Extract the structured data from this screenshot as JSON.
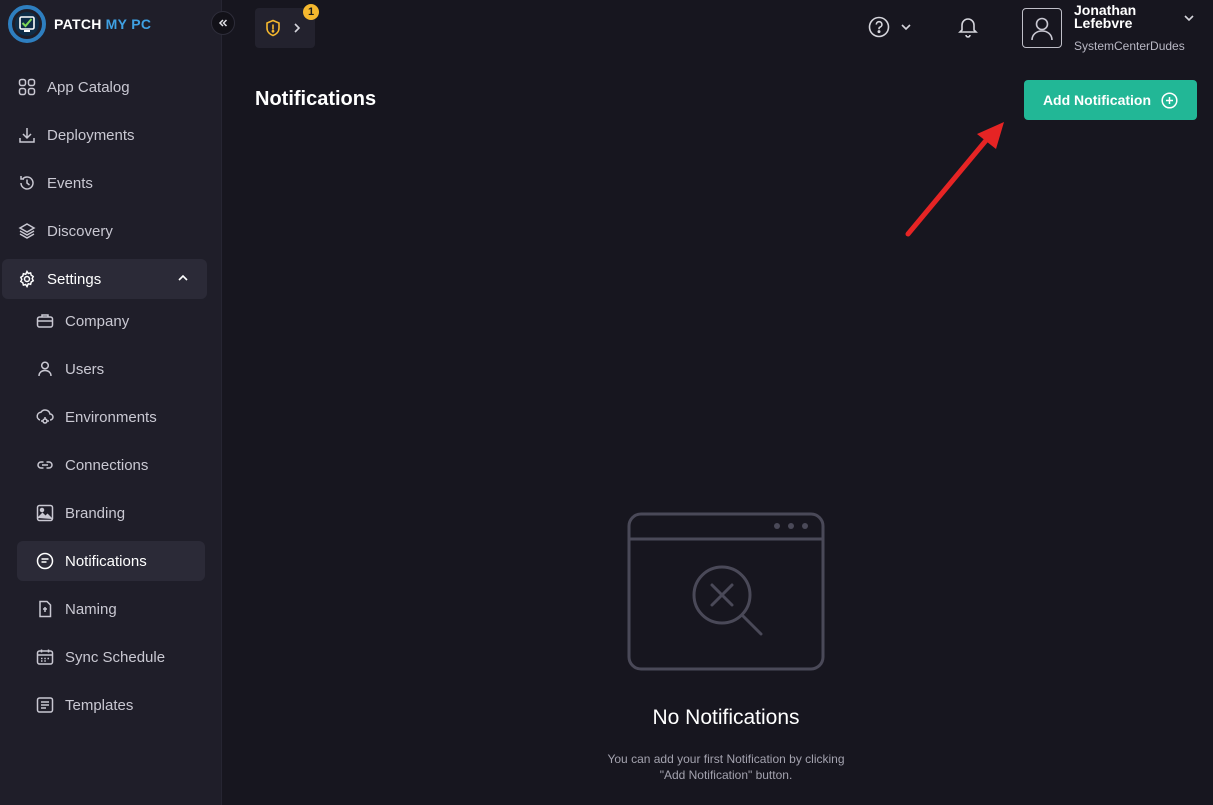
{
  "brand": {
    "name": "PATCH",
    "accent": "MY PC"
  },
  "sidebar": {
    "items": [
      {
        "label": "App Catalog",
        "icon": "grid-icon"
      },
      {
        "label": "Deployments",
        "icon": "download-icon"
      },
      {
        "label": "Events",
        "icon": "history-icon"
      },
      {
        "label": "Discovery",
        "icon": "layers-icon"
      },
      {
        "label": "Settings",
        "icon": "gear-icon"
      }
    ],
    "settings_sub": [
      {
        "label": "Company",
        "icon": "briefcase-icon"
      },
      {
        "label": "Users",
        "icon": "user-icon"
      },
      {
        "label": "Environments",
        "icon": "environment-icon"
      },
      {
        "label": "Connections",
        "icon": "link-icon"
      },
      {
        "label": "Branding",
        "icon": "image-icon"
      },
      {
        "label": "Notifications",
        "icon": "notification-icon"
      },
      {
        "label": "Naming",
        "icon": "naming-icon"
      },
      {
        "label": "Sync Schedule",
        "icon": "calendar-icon"
      },
      {
        "label": "Templates",
        "icon": "template-icon"
      }
    ]
  },
  "topbar": {
    "badge_count": "1",
    "user": {
      "name": "Jonathan Lefebvre",
      "org": "SystemCenterDudes"
    }
  },
  "main": {
    "title": "Notifications",
    "add_button": "Add Notification",
    "empty_title": "No Notifications",
    "empty_desc": "You can add your first Notification by clicking \"Add Notification\" button."
  },
  "colors": {
    "accent": "#22b796",
    "badge": "#f5b82e",
    "arrow": "#e62424",
    "brand_accent": "#3fa1e3"
  }
}
